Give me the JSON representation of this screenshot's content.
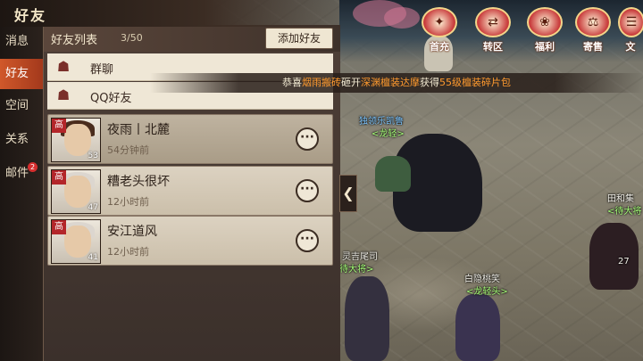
{
  "window": {
    "title": "好友"
  },
  "nav": {
    "items": [
      {
        "label": "消息"
      },
      {
        "label": "好友",
        "active": true
      },
      {
        "label": "空间"
      },
      {
        "label": "关系"
      },
      {
        "label": "邮件",
        "badge": "2"
      }
    ]
  },
  "friends_panel": {
    "list_label": "好友列表",
    "count": "3/50",
    "add_button": "添加好友",
    "groups": [
      {
        "label": "群聊",
        "icon": "group-icon"
      },
      {
        "label": "QQ好友",
        "icon": "qq-icon"
      }
    ],
    "friends": [
      {
        "name": "夜雨丨北麓",
        "last_online": "54分钟前",
        "level": "53",
        "tier": "高"
      },
      {
        "name": "糟老头很坏",
        "last_online": "12小时前",
        "level": "47",
        "tier": "高"
      },
      {
        "name": "安江道风",
        "last_online": "12小时前",
        "level": "41",
        "tier": "高"
      }
    ]
  },
  "broadcast": {
    "parts": [
      {
        "text": "恭喜",
        "color": "#f2ead2"
      },
      {
        "text": "烟雨搬砖",
        "color": "#ff9a2e"
      },
      {
        "text": "砸开",
        "color": "#f2ead2"
      },
      {
        "text": "深渊檀装达摩",
        "color": "#ff9a2e"
      },
      {
        "text": "获得",
        "color": "#f2ead2"
      },
      {
        "text": "55级檀装碎片包",
        "color": "#ff9a2e"
      }
    ]
  },
  "top_icons": [
    {
      "label": "首充",
      "icon": "gift-icon"
    },
    {
      "label": "转区",
      "icon": "transfer-icon"
    },
    {
      "label": "福利",
      "icon": "welfare-icon"
    },
    {
      "label": "寄售",
      "icon": "market-icon"
    },
    {
      "label": "文",
      "icon": "scroll-icon"
    }
  ],
  "scene": {
    "player_name": "独领乐凯鲁",
    "player_title": "<龙轻>",
    "npc_left_name": "灵吉尾司",
    "npc_left_title": "待大将>",
    "npc_bottom_name": "白隐桃笑",
    "npc_bottom_title": "<龙轻头>",
    "npc_right_name": "田和集",
    "npc_right_title": "<待大将",
    "npc_right_level": "27"
  },
  "collapse_button": "❮"
}
